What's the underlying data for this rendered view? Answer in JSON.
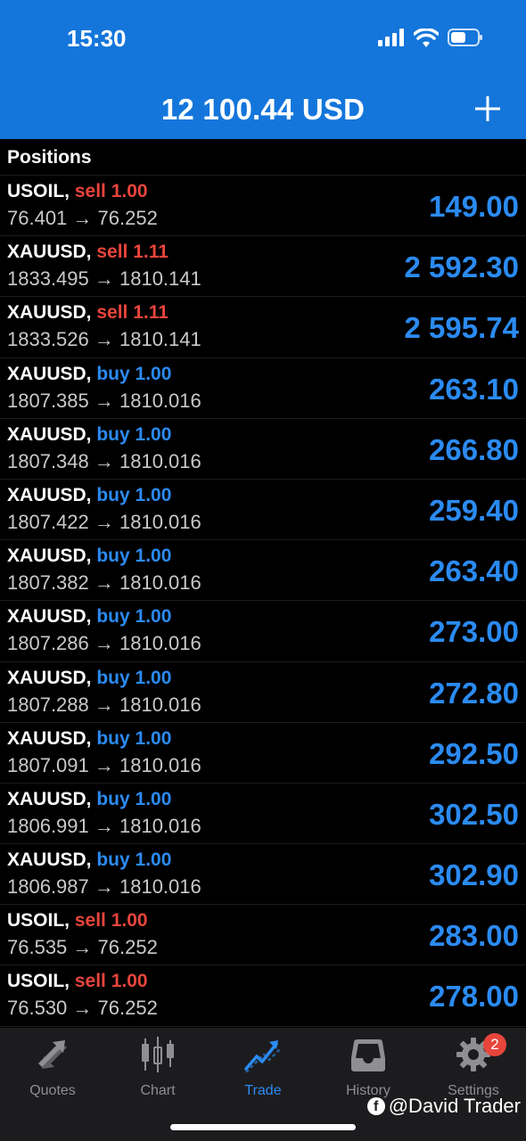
{
  "status_bar": {
    "time": "15:30"
  },
  "header": {
    "balance": "12 100.44 USD",
    "add_icon": "plus-icon"
  },
  "section": {
    "title": "Positions"
  },
  "colors": {
    "header_bg": "#1476DB",
    "sell": "#E8453C",
    "buy": "#2B8BF2",
    "profit": "#2B8BF2"
  },
  "positions": [
    {
      "symbol": "USOIL,",
      "side": "sell",
      "volume": "sell 1.00",
      "prices": "76.401 → 76.252",
      "profit": "149.00"
    },
    {
      "symbol": "XAUUSD,",
      "side": "sell",
      "volume": "sell 1.11",
      "prices": "1833.495 → 1810.141",
      "profit": "2 592.30"
    },
    {
      "symbol": "XAUUSD,",
      "side": "sell",
      "volume": "sell 1.11",
      "prices": "1833.526 → 1810.141",
      "profit": "2 595.74"
    },
    {
      "symbol": "XAUUSD,",
      "side": "buy",
      "volume": "buy 1.00",
      "prices": "1807.385 → 1810.016",
      "profit": "263.10"
    },
    {
      "symbol": "XAUUSD,",
      "side": "buy",
      "volume": "buy 1.00",
      "prices": "1807.348 → 1810.016",
      "profit": "266.80"
    },
    {
      "symbol": "XAUUSD,",
      "side": "buy",
      "volume": "buy 1.00",
      "prices": "1807.422 → 1810.016",
      "profit": "259.40"
    },
    {
      "symbol": "XAUUSD,",
      "side": "buy",
      "volume": "buy 1.00",
      "prices": "1807.382 → 1810.016",
      "profit": "263.40"
    },
    {
      "symbol": "XAUUSD,",
      "side": "buy",
      "volume": "buy 1.00",
      "prices": "1807.286 → 1810.016",
      "profit": "273.00"
    },
    {
      "symbol": "XAUUSD,",
      "side": "buy",
      "volume": "buy 1.00",
      "prices": "1807.288 → 1810.016",
      "profit": "272.80"
    },
    {
      "symbol": "XAUUSD,",
      "side": "buy",
      "volume": "buy 1.00",
      "prices": "1807.091 → 1810.016",
      "profit": "292.50"
    },
    {
      "symbol": "XAUUSD,",
      "side": "buy",
      "volume": "buy 1.00",
      "prices": "1806.991 → 1810.016",
      "profit": "302.50"
    },
    {
      "symbol": "XAUUSD,",
      "side": "buy",
      "volume": "buy 1.00",
      "prices": "1806.987 → 1810.016",
      "profit": "302.90"
    },
    {
      "symbol": "USOIL,",
      "side": "sell",
      "volume": "sell 1.00",
      "prices": "76.535 → 76.252",
      "profit": "283.00"
    },
    {
      "symbol": "USOIL,",
      "side": "sell",
      "volume": "sell 1.00",
      "prices": "76.530 → 76.252",
      "profit": "278.00"
    }
  ],
  "tabs": [
    {
      "label": "Quotes",
      "icon": "quotes-arrows-icon"
    },
    {
      "label": "Chart",
      "icon": "candlestick-icon"
    },
    {
      "label": "Trade",
      "icon": "trend-up-icon",
      "active": true
    },
    {
      "label": "History",
      "icon": "inbox-tray-icon"
    },
    {
      "label": "Settings",
      "icon": "gear-icon",
      "badge": "2"
    }
  ],
  "watermark": {
    "text": "@David Trader",
    "icon": "facebook-icon"
  }
}
